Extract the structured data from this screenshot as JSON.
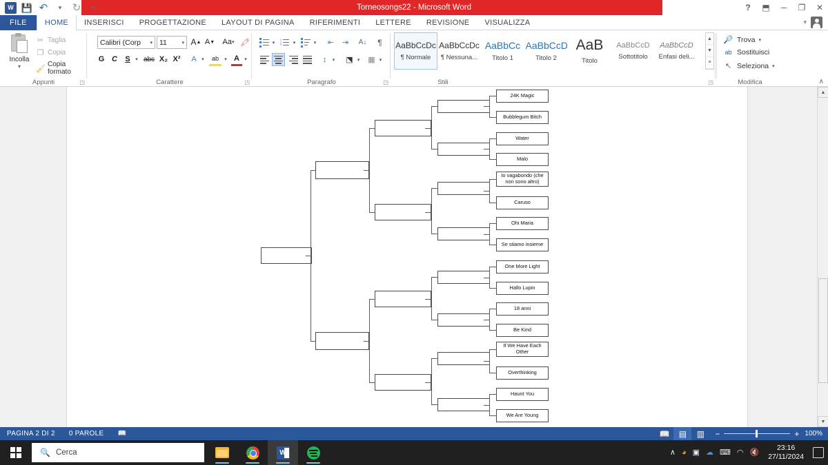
{
  "window": {
    "title": "Torneosongs22 -  Microsoft Word",
    "quick_access": [
      {
        "name": "word-logo",
        "label": "W"
      },
      {
        "name": "save-icon",
        "label": "💾"
      },
      {
        "name": "undo-icon",
        "label": "↶"
      },
      {
        "name": "redo-icon",
        "label": "↻"
      },
      {
        "name": "customize-qat-icon",
        "label": "▾"
      }
    ],
    "controls": {
      "help": "?",
      "ribbon_display": "⬒",
      "minimize": "─",
      "restore": "❐",
      "close": "✕"
    }
  },
  "tabs": {
    "file": "FILE",
    "items": [
      {
        "label": "HOME",
        "active": true
      },
      {
        "label": "INSERISCI",
        "active": false
      },
      {
        "label": "PROGETTAZIONE",
        "active": false
      },
      {
        "label": "LAYOUT DI PAGINA",
        "active": false
      },
      {
        "label": "RIFERIMENTI",
        "active": false
      },
      {
        "label": "LETTERE",
        "active": false
      },
      {
        "label": "REVISIONE",
        "active": false
      },
      {
        "label": "VISUALIZZA",
        "active": false
      }
    ]
  },
  "ribbon": {
    "clipboard": {
      "group_label": "Appunti",
      "paste_label": "Incolla",
      "paste_caret": "▾",
      "cut_label": "Taglia",
      "cut_icon": "✂",
      "copy_label": "Copia",
      "copy_icon": "❐",
      "format_painter_label": "Copia formato",
      "format_painter_icon": "🖌",
      "dialog_launcher": "◳"
    },
    "font": {
      "group_label": "Carattere",
      "font_name": "Calibri (Corp",
      "font_size": "11",
      "grow_font": "A",
      "shrink_font": "A",
      "change_case": "Aa",
      "clear_formatting": "🖍",
      "bold": "G",
      "italic": "C",
      "underline": "S",
      "strikethrough": "abc",
      "subscript": "X₂",
      "superscript": "X²",
      "text_effects": "A",
      "highlight": "ab",
      "font_color": "A",
      "dialog_launcher": "◳"
    },
    "paragraph": {
      "group_label": "Paragrafo",
      "bullets": "bullet-list-icon",
      "numbering": "numbered-list-icon",
      "multilevel": "multilevel-list-icon",
      "decrease_indent": "⇤",
      "increase_indent": "⇥",
      "sort": "A↓",
      "show_marks": "¶",
      "align_left": "align-left-icon",
      "align_center": "align-center-icon",
      "align_right": "align-right-icon",
      "justify": "justify-icon",
      "line_spacing": "↕",
      "shading": "shading-icon",
      "borders": "borders-icon",
      "active_alignment": "align_center",
      "dialog_launcher": "◳"
    },
    "styles": {
      "group_label": "Stili",
      "items": [
        {
          "preview": "AaBbCcDc",
          "name": "¶ Normale",
          "selected": true,
          "variant": "normal"
        },
        {
          "preview": "AaBbCcDc",
          "name": "¶ Nessuna...",
          "selected": false,
          "variant": "normal"
        },
        {
          "preview": "AaBbCc",
          "name": "Titolo 1",
          "selected": false,
          "variant": "blue"
        },
        {
          "preview": "AaBbCcD",
          "name": "Titolo 2",
          "selected": false,
          "variant": "blue"
        },
        {
          "preview": "AaB",
          "name": "Titolo",
          "selected": false,
          "variant": "bigblue"
        },
        {
          "preview": "AaBbCcD",
          "name": "Sottotitolo",
          "selected": false,
          "variant": "grey"
        },
        {
          "preview": "AaBbCcD",
          "name": "Enfasi deli...",
          "selected": false,
          "variant": "ital"
        }
      ],
      "scroll_up": "▲",
      "scroll_down": "▼",
      "more": "≡",
      "dialog_launcher": "◳"
    },
    "editing": {
      "group_label": "Modifica",
      "find_label": "Trova",
      "find_icon": "🔎",
      "find_caret": "▾",
      "replace_label": "Sostituisci",
      "replace_icon": "ab",
      "select_label": "Seleziona",
      "select_icon": "↖",
      "select_caret": "▾",
      "collapse_ribbon": "∧"
    }
  },
  "document": {
    "bracket": {
      "title": "Torneo songs bracket",
      "round_of_16": [
        "24K Magic",
        "Bubblegum Bitch",
        "Water",
        "Malo",
        "Io vagabondo (che non sono altro)",
        "Caruso",
        "Ohi Maria",
        "Se stiamo insieme",
        "One More Light",
        "Hallo Lupin",
        "18 anni",
        "Be Kind",
        "If We Have Each Other",
        "Overthinking",
        "Haunt You",
        "We Are Young"
      ],
      "quarterfinals": [
        "",
        "",
        "",
        "",
        "",
        "",
        "",
        ""
      ],
      "semifinals": [
        "",
        "",
        "",
        ""
      ],
      "finals": [
        "",
        ""
      ],
      "winner": [
        ""
      ]
    },
    "scrollbar": {
      "up_arrow": "▲",
      "down_arrow": "▼"
    }
  },
  "status_bar": {
    "page_info": "PAGINA 2 DI 2",
    "word_count": "0 PAROLE",
    "proofing_icon": "📖",
    "views": [
      {
        "name": "read-mode",
        "icon": "📖",
        "active": false
      },
      {
        "name": "print-layout",
        "icon": "▤",
        "active": true
      },
      {
        "name": "web-layout",
        "icon": "▥",
        "active": false
      }
    ],
    "zoom_out": "−",
    "zoom_in": "+",
    "zoom_level": "100%"
  },
  "taskbar": {
    "start_icon": "windows-logo",
    "search_placeholder": "Cerca",
    "search_icon": "🔍",
    "apps": [
      {
        "name": "file-explorer",
        "active": false
      },
      {
        "name": "google-chrome",
        "active": false
      },
      {
        "name": "microsoft-word",
        "active": true
      },
      {
        "name": "spotify",
        "active": false
      }
    ],
    "tray": [
      {
        "name": "show-hidden-icons",
        "glyph": "∧"
      },
      {
        "name": "nvidia-icon",
        "glyph": "◕"
      },
      {
        "name": "camera-icon",
        "glyph": "▣"
      },
      {
        "name": "onedrive-icon",
        "glyph": "☁"
      },
      {
        "name": "keyboard-layout-icon",
        "glyph": "⌨"
      },
      {
        "name": "wifi-icon",
        "glyph": "◠"
      },
      {
        "name": "volume-muted-icon",
        "glyph": "🔇"
      }
    ],
    "clock_time": "23:16",
    "clock_date": "27/11/2024",
    "notification_icon": "notification-center-icon"
  }
}
